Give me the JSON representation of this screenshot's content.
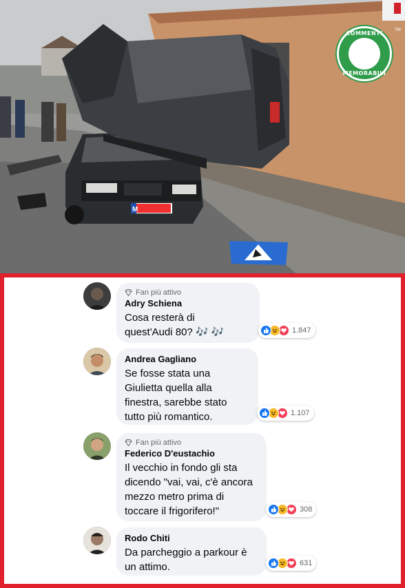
{
  "photo": {
    "badge_top": "COMMENTI",
    "badge_bottom": "MEMORABILI",
    "badge_tm": "TM",
    "license_plate": "M"
  },
  "comments": [
    {
      "top_fan": "Fan più attivo",
      "author": "Adry Schiena",
      "text_lines": [
        "Cosa resterà di",
        "quest'Audi 80? 🎶 🎶"
      ],
      "reaction_count": "1.847"
    },
    {
      "top_fan": "",
      "author": "Andrea Gagliano",
      "text_lines": [
        "Se fosse stata una",
        "Giulietta quella alla",
        "finestra, sarebbe stato",
        "tutto più romantico."
      ],
      "reaction_count": "1.107"
    },
    {
      "top_fan": "Fan più attivo",
      "author": "Federico D'eustachio",
      "text_lines": [
        "Il vecchio in fondo gli sta",
        "dicendo \"vai, vai, c'è ancora",
        "mezzo metro prima di",
        "toccare il frigorifero!\""
      ],
      "reaction_count": "308"
    },
    {
      "top_fan": "",
      "author": "Rodo Chiti",
      "text_lines": [
        "Da parcheggio a parkour è",
        "un attimo."
      ],
      "reaction_count": "631"
    }
  ],
  "colors": {
    "frame": "#e0202a",
    "bubble": "#f0f2f5",
    "like": "#1877f2",
    "haha": "#f7b928",
    "love": "#f33e58",
    "badge": "#2f9c4a"
  },
  "icons": [
    "diamond-icon",
    "like-icon",
    "haha-icon",
    "love-icon"
  ]
}
